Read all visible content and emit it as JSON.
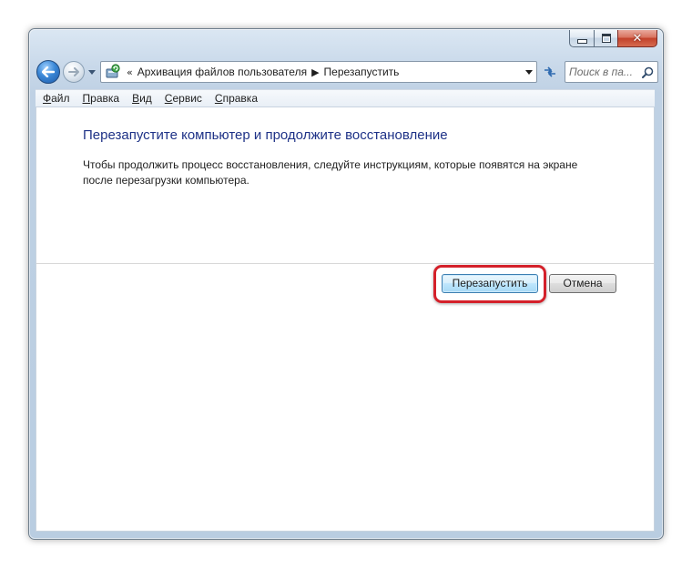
{
  "window": {
    "caption_buttons": {
      "minimize_icon": "minimize-icon",
      "maximize_icon": "maximize-icon",
      "close_glyph": "✕"
    }
  },
  "navigation": {
    "breadcrumb": [
      "Архивация файлов пользователя",
      "Перезапустить"
    ],
    "search_placeholder": "Поиск в па..."
  },
  "menu": {
    "items": [
      {
        "accel": "Ф",
        "rest": "айл"
      },
      {
        "accel": "П",
        "rest": "равка"
      },
      {
        "accel": "В",
        "rest": "ид"
      },
      {
        "accel": "С",
        "rest": "ервис"
      },
      {
        "accel": "С",
        "rest": "правка"
      }
    ]
  },
  "content": {
    "title": "Перезапустите компьютер и продолжите восстановление",
    "description": "Чтобы продолжить процесс восстановления, следуйте инструкциям, которые появятся на экране после перезагрузки компьютера."
  },
  "buttons": {
    "restart_label": "Перезапустить",
    "cancel_label": "Отмена"
  },
  "colors": {
    "title_text": "#1e3287",
    "highlight_border": "#d4202a",
    "window_frame": "#bfd1e4"
  }
}
